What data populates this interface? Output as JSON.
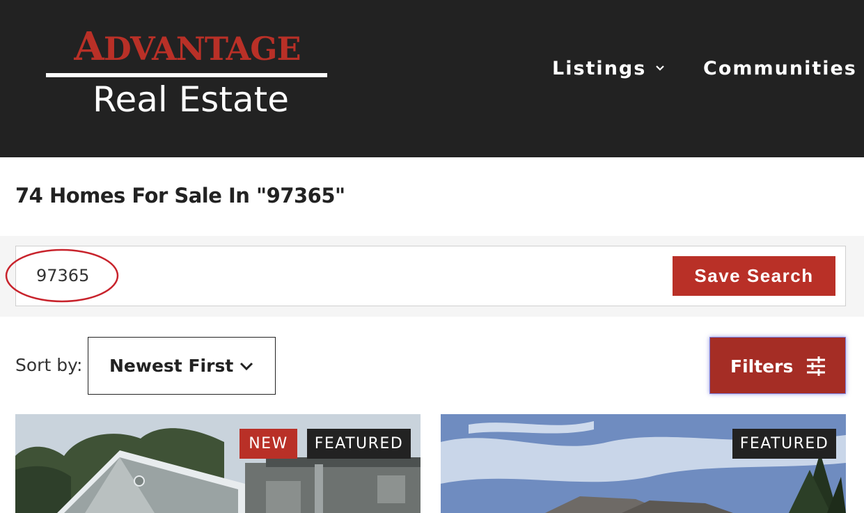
{
  "brand": {
    "logo_top_first": "A",
    "logo_top_rest": "DVANTAGE",
    "logo_bottom": "Real Estate",
    "accent_color": "#b93027",
    "header_bg": "#222222"
  },
  "nav": {
    "items": [
      {
        "label": "Listings",
        "icon": "chevron-down-icon"
      },
      {
        "label": "Communities",
        "icon": "chevron-down-icon"
      }
    ]
  },
  "page": {
    "title": "74 Homes For Sale In \"97365\""
  },
  "search": {
    "value": "97365",
    "save_label": "Save Search"
  },
  "sort": {
    "label": "Sort by:",
    "selected": "Newest First",
    "icon": "chevron-down-icon"
  },
  "filters": {
    "label": "Filters",
    "icon": "sliders-icon"
  },
  "listings": [
    {
      "badges": [
        "NEW",
        "FEATURED"
      ],
      "badge_colors": [
        "#b93027",
        "#222222"
      ]
    },
    {
      "badges": [
        "FEATURED"
      ],
      "badge_colors": [
        "#222222"
      ]
    }
  ]
}
